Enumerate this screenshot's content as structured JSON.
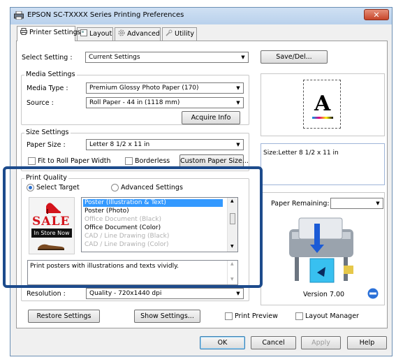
{
  "window": {
    "title": "EPSON SC-TXXXX Series Printing Preferences",
    "close_glyph": "✕"
  },
  "tabs": [
    {
      "label": "Printer Settings"
    },
    {
      "label": "Layout"
    },
    {
      "label": "Advanced"
    },
    {
      "label": "Utility"
    }
  ],
  "select_setting": {
    "label": "Select Setting :",
    "value": "Current Settings",
    "save_label": "Save/Del..."
  },
  "media": {
    "group_title": "Media Settings",
    "media_type_label": "Media Type :",
    "media_type_value": "Premium Glossy Photo Paper (170)",
    "source_label": "Source :",
    "source_value": "Roll Paper - 44 in (1118 mm)",
    "acquire_label": "Acquire Info"
  },
  "size": {
    "group_title": "Size Settings",
    "paper_size_label": "Paper Size :",
    "paper_size_value": "Letter 8 1/2 x 11 in",
    "fit_label": "Fit to Roll Paper Width",
    "borderless_label": "Borderless",
    "custom_label": "Custom Paper Size..."
  },
  "preview": {
    "letter": "A",
    "size_text": "Size:Letter 8 1/2 x 11 in",
    "paper_remaining_label": "Paper Remaining:",
    "version": "Version 7.00"
  },
  "quality": {
    "group_title": "Print Quality",
    "select_target_label": "Select Target",
    "advanced_label": "Advanced Settings",
    "sale_text": "SALE",
    "instore_text": "In Store Now",
    "targets": [
      "Poster (Illustration & Text)",
      "Poster (Photo)",
      "Office Document (Black)",
      "Office Document (Color)",
      "CAD / Line Drawing (Black)",
      "CAD / Line Drawing (Color)"
    ],
    "description": "Print posters with illustrations and texts vividly.",
    "resolution_label": "Resolution :",
    "resolution_value": "Quality - 720x1440 dpi"
  },
  "bottom": {
    "restore_label": "Restore Settings",
    "show_label": "Show Settings...",
    "print_preview_label": "Print Preview",
    "layout_manager_label": "Layout Manager"
  },
  "dialog": {
    "ok": "OK",
    "cancel": "Cancel",
    "apply": "Apply",
    "help": "Help"
  },
  "colors": {
    "accent": "#3399ff",
    "highlight_border": "#1d4b8c",
    "sale_red": "#d4141c"
  }
}
